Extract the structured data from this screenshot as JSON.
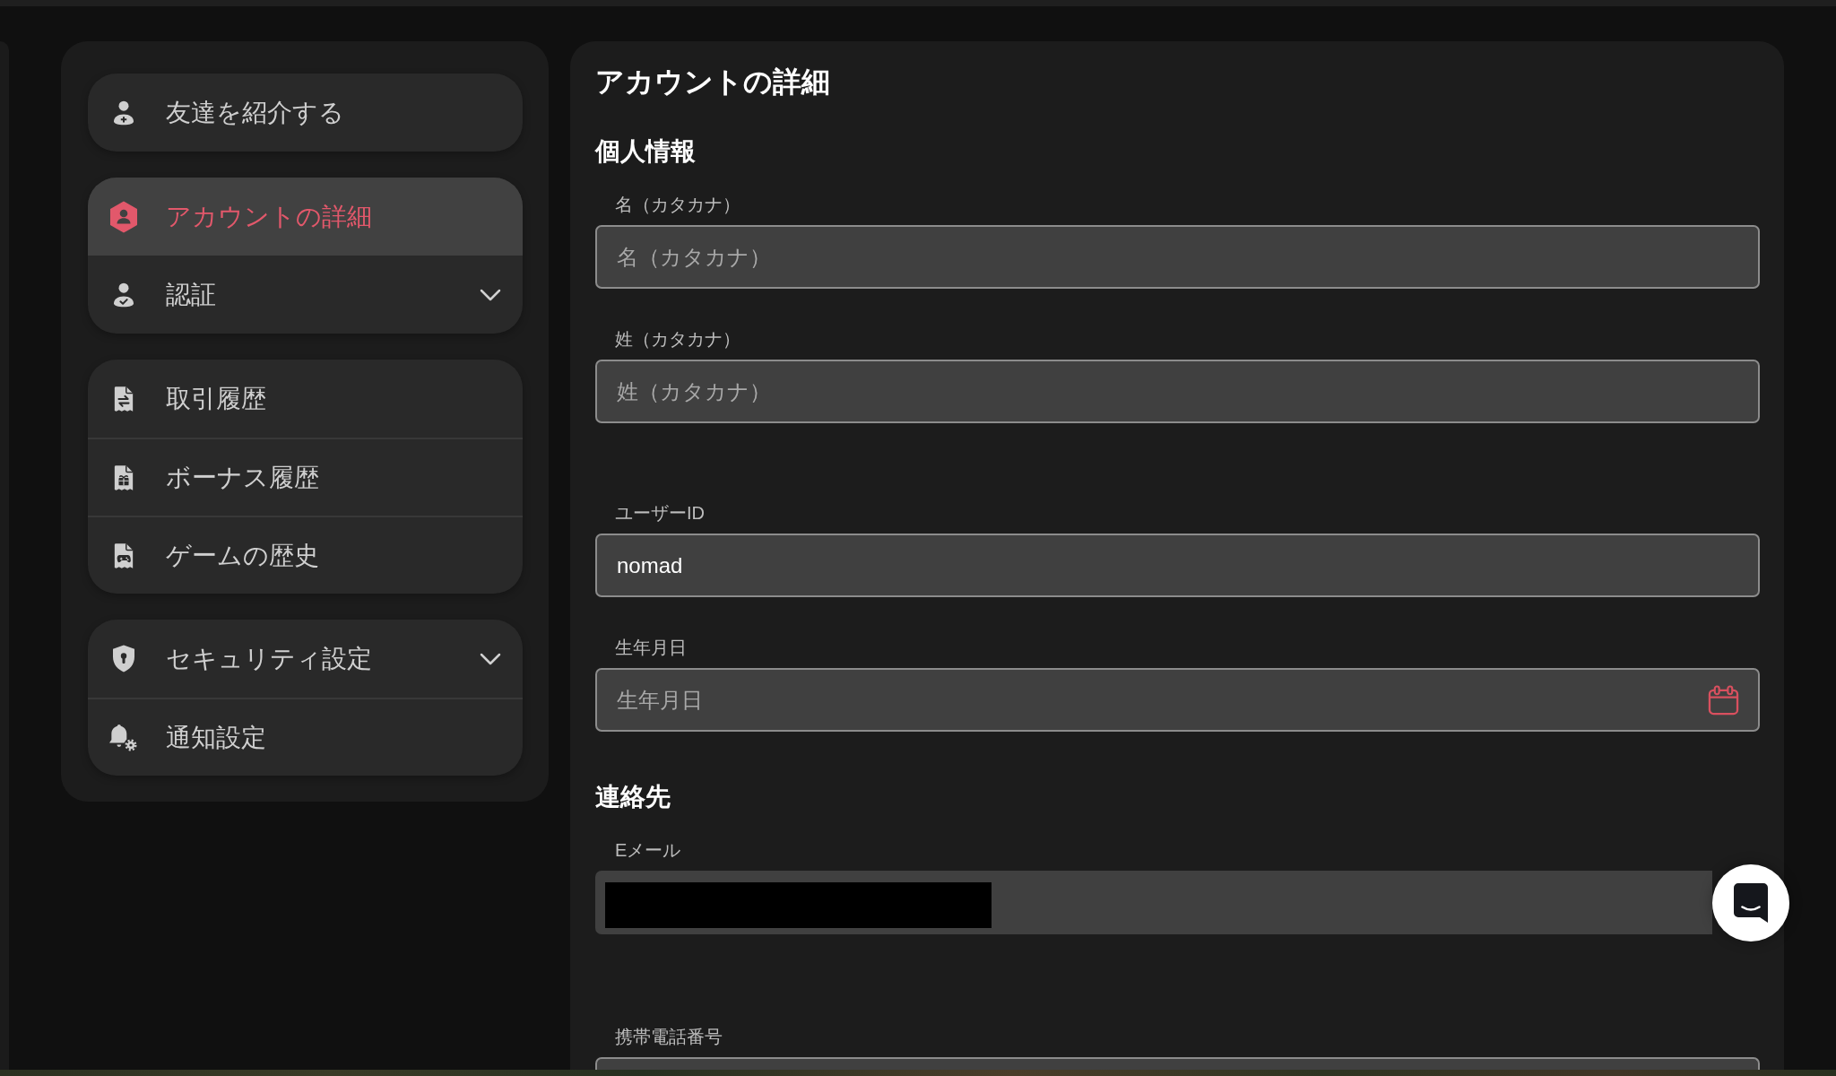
{
  "sidebar": {
    "groups": [
      {
        "items": [
          {
            "label": "友達を紹介する",
            "kind": "link",
            "selected": false
          }
        ]
      },
      {
        "items": [
          {
            "label": "アカウントの詳細",
            "kind": "link",
            "selected": true
          },
          {
            "label": "認証",
            "kind": "dropdown",
            "selected": false,
            "expanded": false
          }
        ]
      },
      {
        "items": [
          {
            "label": "取引履歴",
            "kind": "link",
            "selected": false
          },
          {
            "label": "ボーナス履歴",
            "kind": "link",
            "selected": false
          },
          {
            "label": "ゲームの歴史",
            "kind": "link",
            "selected": false
          }
        ]
      },
      {
        "items": [
          {
            "label": "セキュリティ設定",
            "kind": "dropdown",
            "selected": false,
            "expanded": false
          },
          {
            "label": "通知設定",
            "kind": "link",
            "selected": false
          }
        ]
      }
    ]
  },
  "account_details": {
    "title": "アカウントの詳細",
    "sections": [
      {
        "heading": "個人情報",
        "fields": [
          {
            "label": "名（カタカナ）",
            "kind": "text",
            "placeholder": "名（カタカナ）"
          },
          {
            "label": "姓（カタカナ）",
            "kind": "text",
            "placeholder": "姓（カタカナ）"
          },
          {
            "label": "ユーザーID",
            "kind": "text",
            "value": "nomad"
          },
          {
            "label": "生年月日",
            "kind": "date",
            "placeholder": "生年月日"
          }
        ]
      },
      {
        "heading": "連絡先",
        "fields": [
          {
            "label": "Eメール",
            "kind": "redacted"
          },
          {
            "label": "携帯電話番号",
            "kind": "text"
          }
        ]
      }
    ]
  }
}
